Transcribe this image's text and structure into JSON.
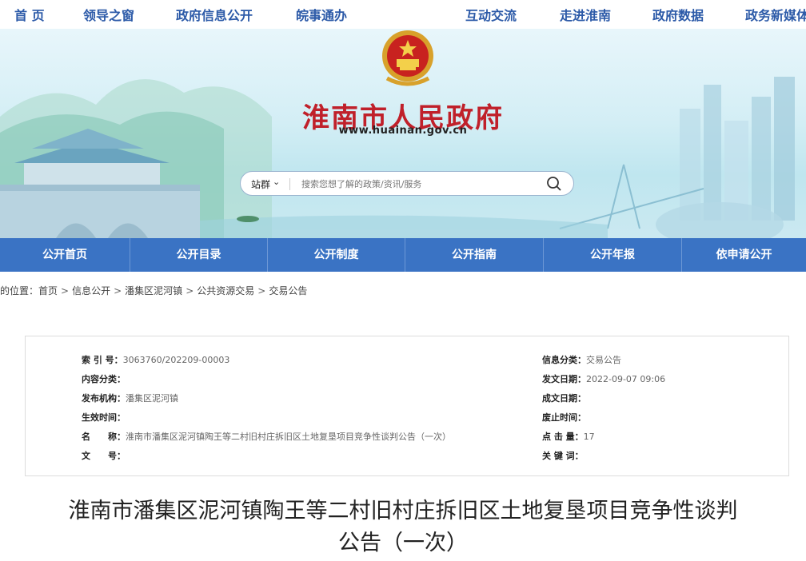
{
  "topnav": {
    "items": [
      "首 页",
      "领导之窗",
      "政府信息公开",
      "皖事通办",
      "互动交流",
      "走进淮南",
      "政府数据",
      "政务新媒体"
    ]
  },
  "banner": {
    "title": "淮南市人民政府",
    "url": "www.huainan.gov.cn",
    "search": {
      "scope": "站群",
      "placeholder": "搜索您想了解的政策/资讯/服务"
    }
  },
  "bluenav": {
    "tabs": [
      "公开首页",
      "公开目录",
      "公开制度",
      "公开指南",
      "公开年报",
      "依申请公开"
    ]
  },
  "breadcrumb": {
    "prefix": "您的位置：",
    "items": [
      "首页",
      "信息公开",
      "潘集区泥河镇",
      "公共资源交易",
      "交易公告"
    ]
  },
  "info": {
    "left": [
      {
        "label": "索 引 号：",
        "value": "3063760/202209-00003"
      },
      {
        "label": "内容分类：",
        "value": ""
      },
      {
        "label": "发布机构：",
        "value": "潘集区泥河镇"
      },
      {
        "label": "生效时间：",
        "value": ""
      },
      {
        "label": "名　　称：",
        "value": "淮南市潘集区泥河镇陶王等二村旧村庄拆旧区土地复垦项目竞争性谈判公告（一次）"
      },
      {
        "label": "文　　号：",
        "value": ""
      }
    ],
    "right": [
      {
        "label": "信息分类：",
        "value": "交易公告"
      },
      {
        "label": "发文日期：",
        "value": "2022-09-07 09:06"
      },
      {
        "label": "成文日期：",
        "value": ""
      },
      {
        "label": "废止时间：",
        "value": ""
      },
      {
        "label": "点 击 量：",
        "value": "17"
      },
      {
        "label": "关 键 词：",
        "value": ""
      }
    ]
  },
  "document": {
    "title_line1": "淮南市潘集区泥河镇陶王等二村旧村庄拆旧区土地复垦项目竞争性谈判",
    "title_line2": "公告（一次）"
  },
  "colors": {
    "brand_blue": "#3a73c4",
    "title_red": "#c0202a",
    "nav_text": "#2c5aa8"
  }
}
